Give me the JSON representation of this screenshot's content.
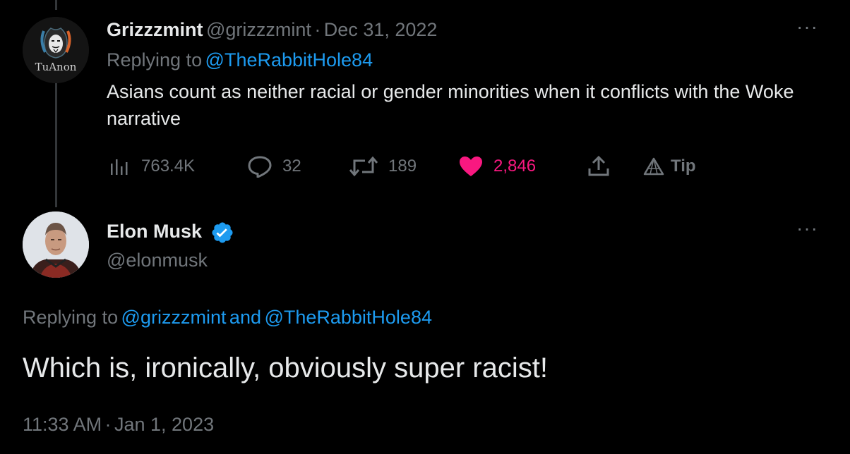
{
  "tweet1": {
    "author_name": "Grizzzmint",
    "handle": "@grizzzmint",
    "separator": "·",
    "date": "Dec 31, 2022",
    "replying_prefix": "Replying to",
    "replying_handle": "@TheRabbitHole84",
    "text": "Asians count as neither racial or gender minorities when it conflicts with the Woke narrative",
    "avatar_label": "TuAnon",
    "stats": {
      "views": "763.4K",
      "replies": "32",
      "retweets": "189",
      "likes": "2,846",
      "tip_label": "Tip"
    },
    "more_label": "···"
  },
  "tweet2": {
    "author_name": "Elon Musk",
    "handle": "@elonmusk",
    "replying_prefix": "Replying to",
    "replying_handle_1": "@grizzzmint",
    "replying_and": "and",
    "replying_handle_2": "@TheRabbitHole84",
    "text": "Which is, ironically, obviously super racist!",
    "time": "11:33 AM",
    "separator": "·",
    "date": "Jan 1, 2023",
    "more_label": "···"
  },
  "colors": {
    "background": "#000000",
    "text": "#e7e9ea",
    "muted": "#71767b",
    "link": "#1d9bf0",
    "like": "#f91880",
    "verified": "#1d9bf0"
  },
  "icons": [
    "views-icon",
    "reply-icon",
    "retweet-icon",
    "like-heart-icon",
    "share-icon",
    "tip-icon",
    "verified-badge-icon",
    "more-icon"
  ]
}
